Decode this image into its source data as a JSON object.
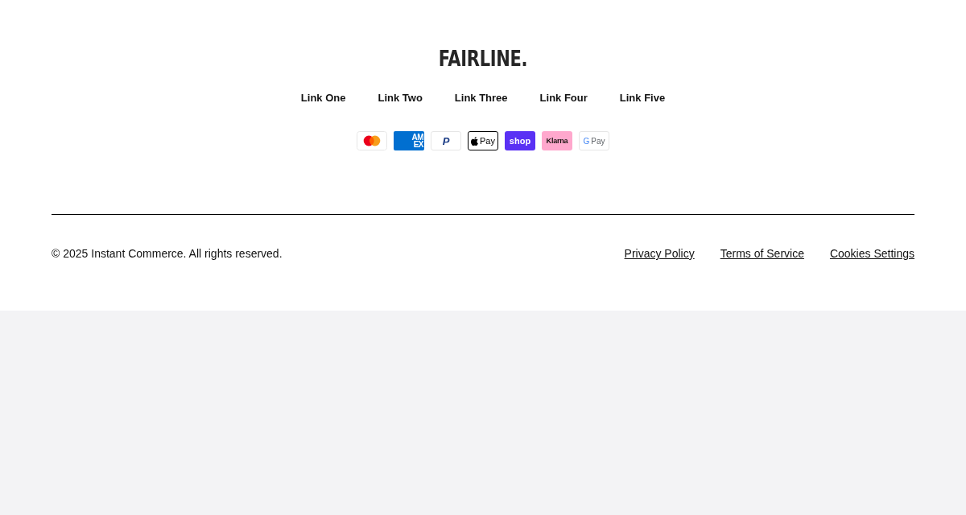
{
  "footer": {
    "brand": "FAIRLINE.",
    "links": [
      "Link One",
      "Link Two",
      "Link Three",
      "Link Four",
      "Link Five"
    ],
    "payment_methods": [
      {
        "kind": "circles"
      },
      {
        "kind": "stacked",
        "lines": [
          "AM",
          "EX"
        ]
      },
      {
        "kind": "letter",
        "label": "P"
      },
      {
        "kind": "apple",
        "label": "Pay"
      },
      {
        "kind": "violet",
        "label": "shop"
      },
      {
        "kind": "pink",
        "label": "Klarna"
      },
      {
        "kind": "gword",
        "mark": "G",
        "label": "Pay"
      }
    ],
    "copyright": "© 2025 Instant Commerce. All rights reserved.",
    "legal_links": [
      "Privacy Policy",
      "Terms of Service",
      "Cookies Settings"
    ]
  }
}
